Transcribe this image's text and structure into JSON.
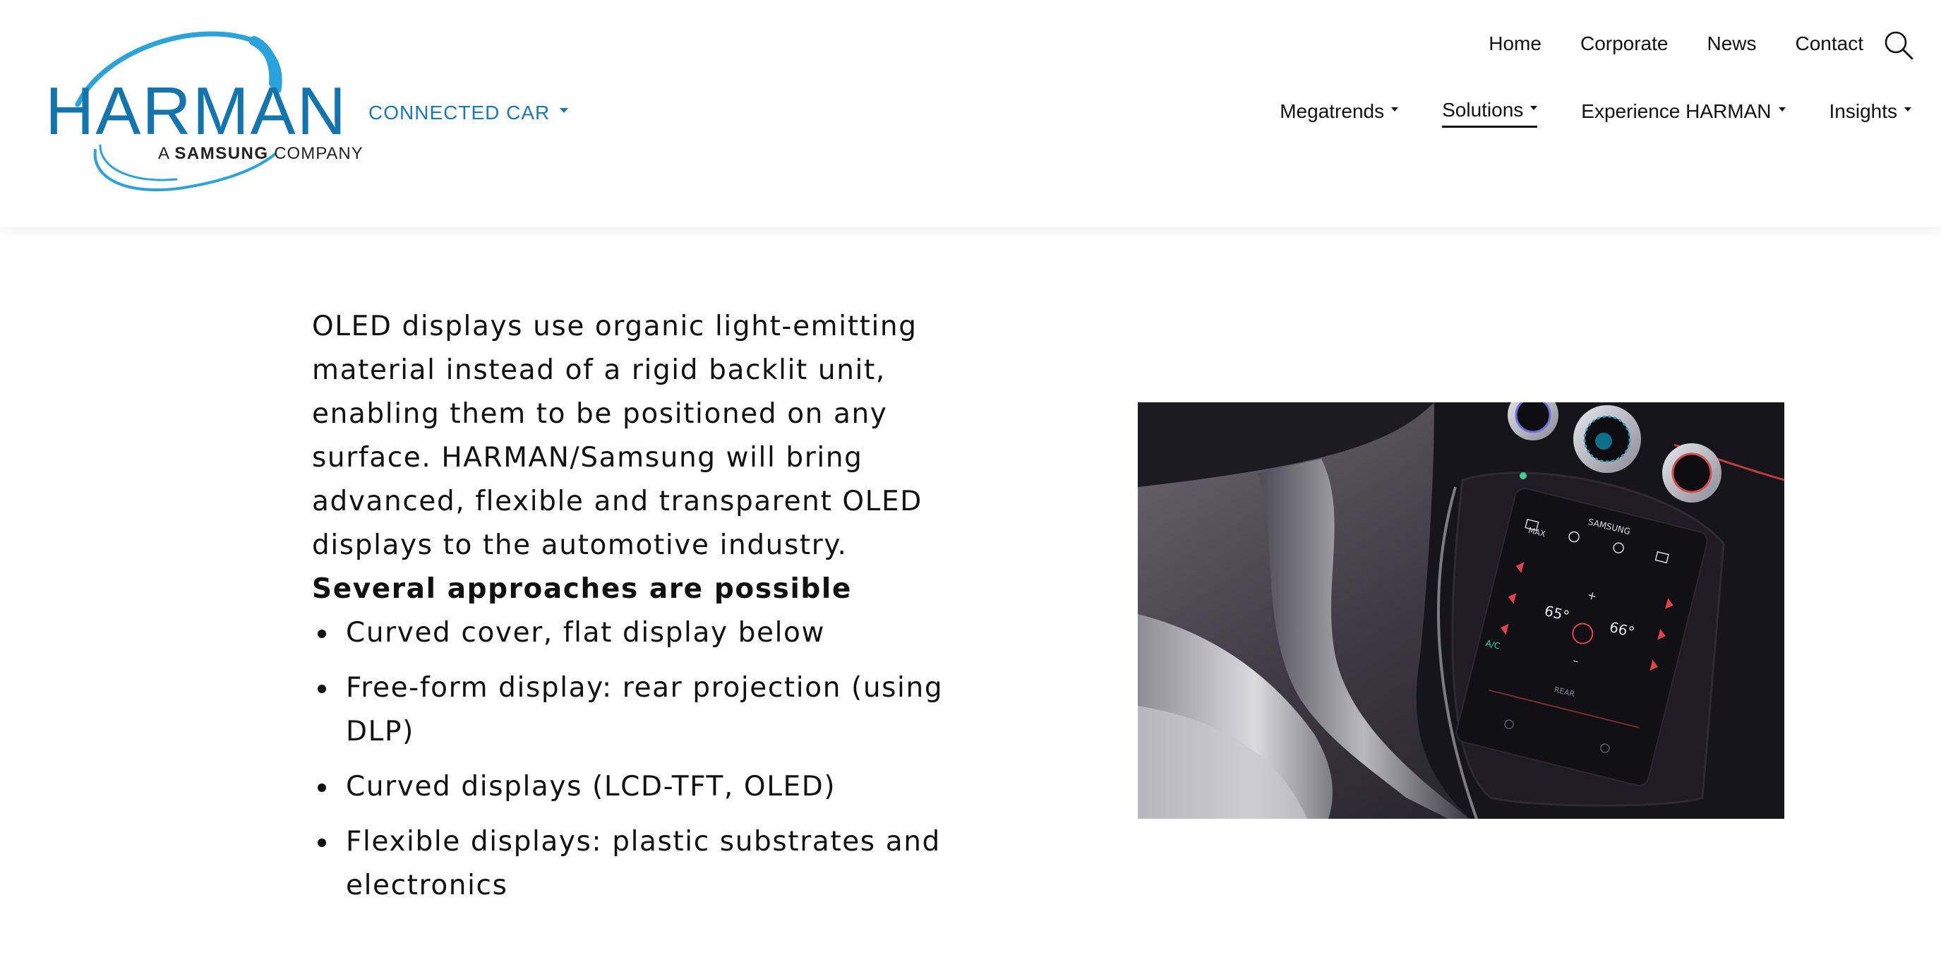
{
  "header": {
    "logo": {
      "wordmark": "HARMAN",
      "tagline_prefix": "A",
      "tagline_brand": "SAMSUNG",
      "tagline_suffix": "COMPANY",
      "color": "#1474ad",
      "swoosh_color": "#2aa3dc"
    },
    "section_switcher": {
      "label": "CONNECTED CAR"
    },
    "top_nav": [
      {
        "label": "Home"
      },
      {
        "label": "Corporate"
      },
      {
        "label": "News"
      },
      {
        "label": "Contact"
      }
    ],
    "search_icon": "search-icon",
    "main_nav": [
      {
        "label": "Megatrends",
        "active": false
      },
      {
        "label": "Solutions",
        "active": true
      },
      {
        "label": "Experience HARMAN",
        "active": false
      },
      {
        "label": "Insights",
        "active": false
      }
    ]
  },
  "content": {
    "intro": "OLED displays use organic light-emitting material instead of a rigid backlit unit, enabling them to be positioned on any surface. HARMAN/Samsung will bring advanced, flexible and transparent OLED displays to the automotive industry.",
    "subheading": "Several approaches are possible",
    "bullets": [
      "Curved cover, flat display below",
      "Free-form display: rear projection (using DLP)",
      "Curved displays (LCD-TFT, OLED)",
      "Flexible displays: plastic substrates and electronics"
    ],
    "image": {
      "screen_brand": "SAMSUNG",
      "left_temp": "65°",
      "right_temp": "66°",
      "ac_label": "A/C",
      "rear_label": "REAR",
      "max_label": "MAX"
    }
  }
}
